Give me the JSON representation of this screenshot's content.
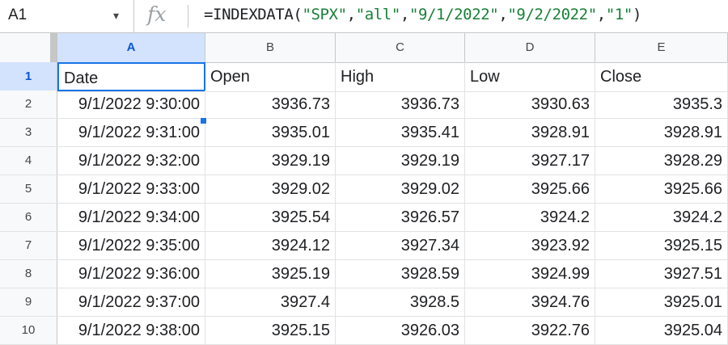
{
  "formula_bar": {
    "name_box": "A1",
    "name_box_arrow": "▾",
    "fx_label": "fx",
    "formula": {
      "prefix": "=INDEXDATA(",
      "arg1": "\"SPX\"",
      "arg2": "\"all\"",
      "arg3": "\"9/1/2022\"",
      "arg4": "\"9/2/2022\"",
      "arg5": "\"1\"",
      "comma": ",",
      "suffix": ")"
    }
  },
  "columns": [
    "A",
    "B",
    "C",
    "D",
    "E"
  ],
  "active_column": "A",
  "active_row": "1",
  "header_row": {
    "row_number": "1",
    "cells": [
      "Date",
      "Open",
      "High",
      "Low",
      "Close"
    ]
  },
  "rows": [
    {
      "row_number": "2",
      "cells": [
        "9/1/2022 9:30:00",
        "3936.73",
        "3936.73",
        "3930.63",
        "3935.3"
      ]
    },
    {
      "row_number": "3",
      "cells": [
        "9/1/2022 9:31:00",
        "3935.01",
        "3935.41",
        "3928.91",
        "3928.91"
      ]
    },
    {
      "row_number": "4",
      "cells": [
        "9/1/2022 9:32:00",
        "3929.19",
        "3929.19",
        "3927.17",
        "3928.29"
      ]
    },
    {
      "row_number": "5",
      "cells": [
        "9/1/2022 9:33:00",
        "3929.02",
        "3929.02",
        "3925.66",
        "3925.66"
      ]
    },
    {
      "row_number": "6",
      "cells": [
        "9/1/2022 9:34:00",
        "3925.54",
        "3926.57",
        "3924.2",
        "3924.2"
      ]
    },
    {
      "row_number": "7",
      "cells": [
        "9/1/2022 9:35:00",
        "3924.12",
        "3927.34",
        "3923.92",
        "3925.15"
      ]
    },
    {
      "row_number": "8",
      "cells": [
        "9/1/2022 9:36:00",
        "3925.19",
        "3928.59",
        "3924.99",
        "3927.51"
      ]
    },
    {
      "row_number": "9",
      "cells": [
        "9/1/2022 9:37:00",
        "3927.4",
        "3928.5",
        "3924.76",
        "3925.01"
      ]
    },
    {
      "row_number": "10",
      "cells": [
        "9/1/2022 9:38:00",
        "3925.15",
        "3926.03",
        "3922.76",
        "3925.04"
      ]
    }
  ],
  "colors": {
    "selection": "#1a73e8",
    "header_bg": "#f8f9fa",
    "active_header_bg": "#d3e3fd",
    "string_token": "#188038"
  }
}
